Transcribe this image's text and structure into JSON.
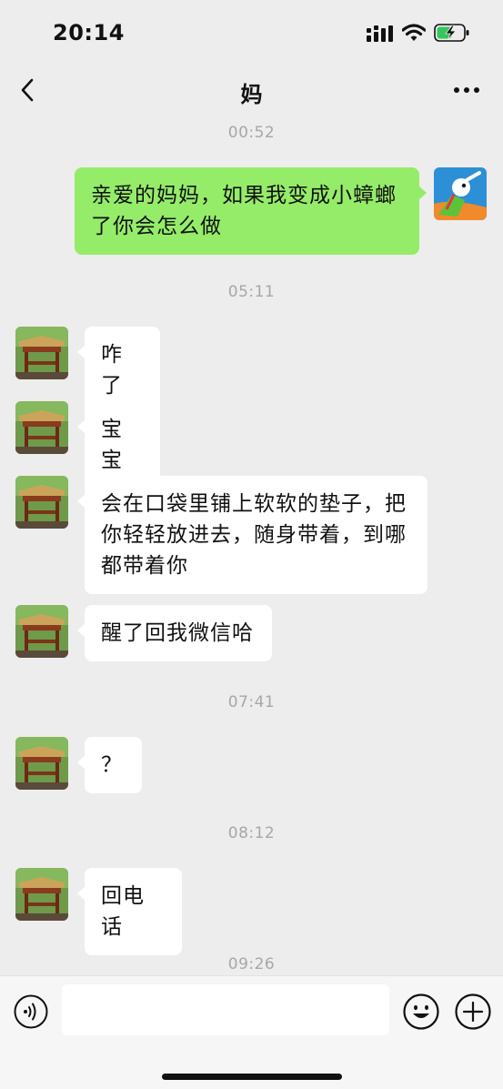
{
  "status_bar": {
    "time": "20:14",
    "battery_charging": true
  },
  "header": {
    "title": "妈"
  },
  "input": {
    "placeholder": ""
  },
  "chat": {
    "timestamps": [
      "00:52",
      "05:11",
      "07:41",
      "08:12",
      "09:26"
    ],
    "messages": [
      {
        "sender": "me",
        "text": "亲爱的妈妈，如果我变成小蟑螂了你会怎么做"
      },
      {
        "sender": "mom",
        "text": "咋了"
      },
      {
        "sender": "mom",
        "text": "宝宝"
      },
      {
        "sender": "mom",
        "text": "会在口袋里铺上软软的垫子，把你轻轻放进去，随身带着，到哪都带着你"
      },
      {
        "sender": "mom",
        "text": "醒了回我微信哈"
      },
      {
        "sender": "mom",
        "text": "？"
      },
      {
        "sender": "mom",
        "text": "回电话"
      }
    ]
  },
  "colors": {
    "background": "#ededed",
    "bubble_me": "#95ec69",
    "bubble_other": "#ffffff",
    "timestamp": "#a7a7a7"
  },
  "icons": [
    "back-icon",
    "more-icon",
    "signal-icon",
    "wifi-icon",
    "battery-icon",
    "voice-icon",
    "emoji-icon",
    "plus-icon"
  ]
}
